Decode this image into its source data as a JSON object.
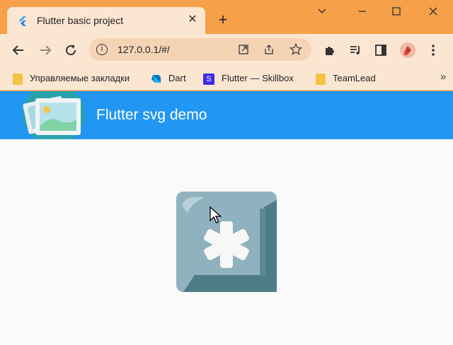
{
  "browser": {
    "tab": {
      "title": "Flutter basic project"
    },
    "toolbar": {
      "url": "127.0.0.1/#/"
    },
    "bookmarks": [
      {
        "label": "Управляемые закладки",
        "icon": "folder-icon",
        "color": "#f3c443"
      },
      {
        "label": "Dart",
        "icon": "dart-logo-icon",
        "color": "#0175c2"
      },
      {
        "label": "Flutter — Skillbox",
        "icon": "skillbox-logo-icon",
        "color": "#3d2ae8"
      },
      {
        "label": "TeamLead",
        "icon": "folder-icon",
        "color": "#f3c443"
      }
    ],
    "colors": {
      "frame": "#f6a04a",
      "toolbar": "#fbe6d2",
      "omnibox": "#f5d4b6"
    }
  },
  "app": {
    "title": "Flutter svg demo",
    "colors": {
      "appbar": "#2196f3",
      "background": "#fafafa",
      "key_face": "#8fb2be",
      "key_edge": "#4d7c87"
    }
  }
}
